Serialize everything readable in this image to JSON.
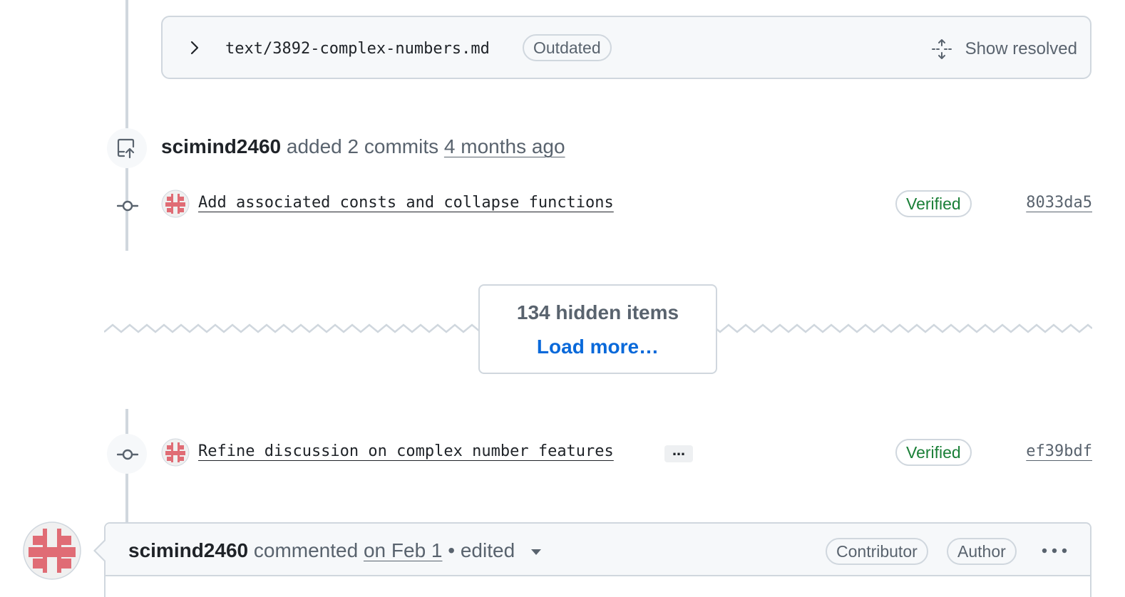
{
  "review": {
    "file_path": "text/3892-complex-numbers.md",
    "status_badge": "Outdated",
    "show_resolved_label": "Show resolved"
  },
  "push_event": {
    "user": "scimind2460",
    "action": "added 2 commits",
    "time": "4 months ago"
  },
  "commits": [
    {
      "message": "Add associated consts and collapse functions",
      "verified": "Verified",
      "sha": "8033da5"
    },
    {
      "message": "Refine discussion on complex number features",
      "verified": "Verified",
      "sha": "ef39bdf",
      "ellipsis": "…"
    }
  ],
  "hidden": {
    "count_label": "134 hidden items",
    "load_more_label": "Load more…"
  },
  "comment": {
    "user": "scimind2460",
    "action": "commented",
    "date": "on Feb 1",
    "edited": "• edited",
    "roles": [
      "Contributor",
      "Author"
    ]
  },
  "colors": {
    "avatar": "#e06c75",
    "verified": "#1a7f37",
    "link": "#0969da",
    "border": "#d0d7de"
  }
}
